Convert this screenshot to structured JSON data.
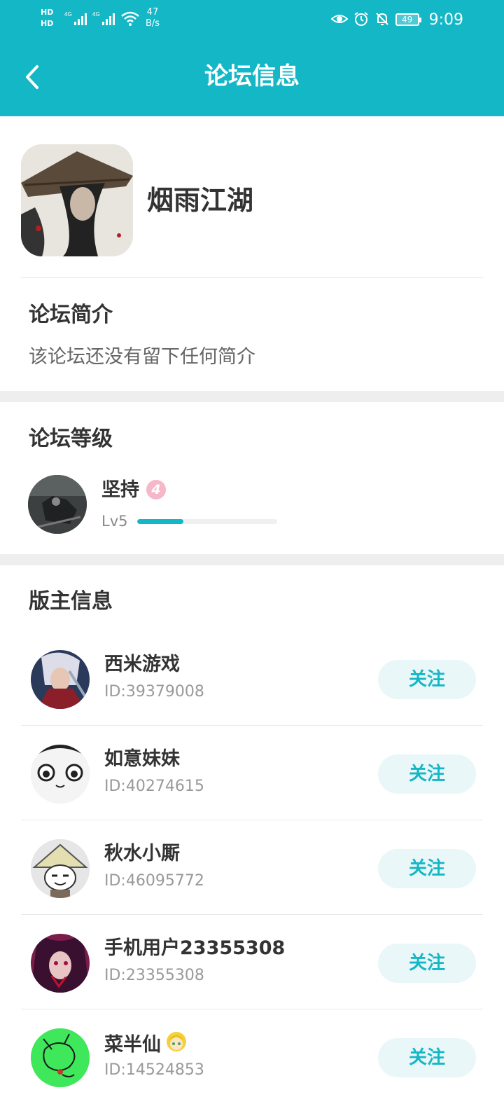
{
  "status_bar": {
    "hd1": "HD",
    "hd2": "HD",
    "sig1": "4G",
    "sig2": "4G",
    "net_speed_value": "47",
    "net_speed_unit": "B/s",
    "battery": "49",
    "time": "9:09"
  },
  "header": {
    "title": "论坛信息"
  },
  "forum": {
    "name": "烟雨江湖"
  },
  "intro": {
    "title": "论坛简介",
    "text": "该论坛还没有留下任何简介"
  },
  "level": {
    "title": "论坛等级",
    "name": "坚持",
    "badge": "4",
    "label": "Lv5",
    "progress": 0.33
  },
  "moderators": {
    "title": "版主信息",
    "follow_label": "关注",
    "items": [
      {
        "name": "西米游戏",
        "id": "ID:39379008"
      },
      {
        "name": "如意妹妹",
        "id": "ID:40274615"
      },
      {
        "name": "秋水小厮",
        "id": "ID:46095772"
      },
      {
        "name": "手机用户23355308",
        "id": "ID:23355308"
      },
      {
        "name": "菜半仙",
        "id": "ID:14524853"
      }
    ]
  }
}
